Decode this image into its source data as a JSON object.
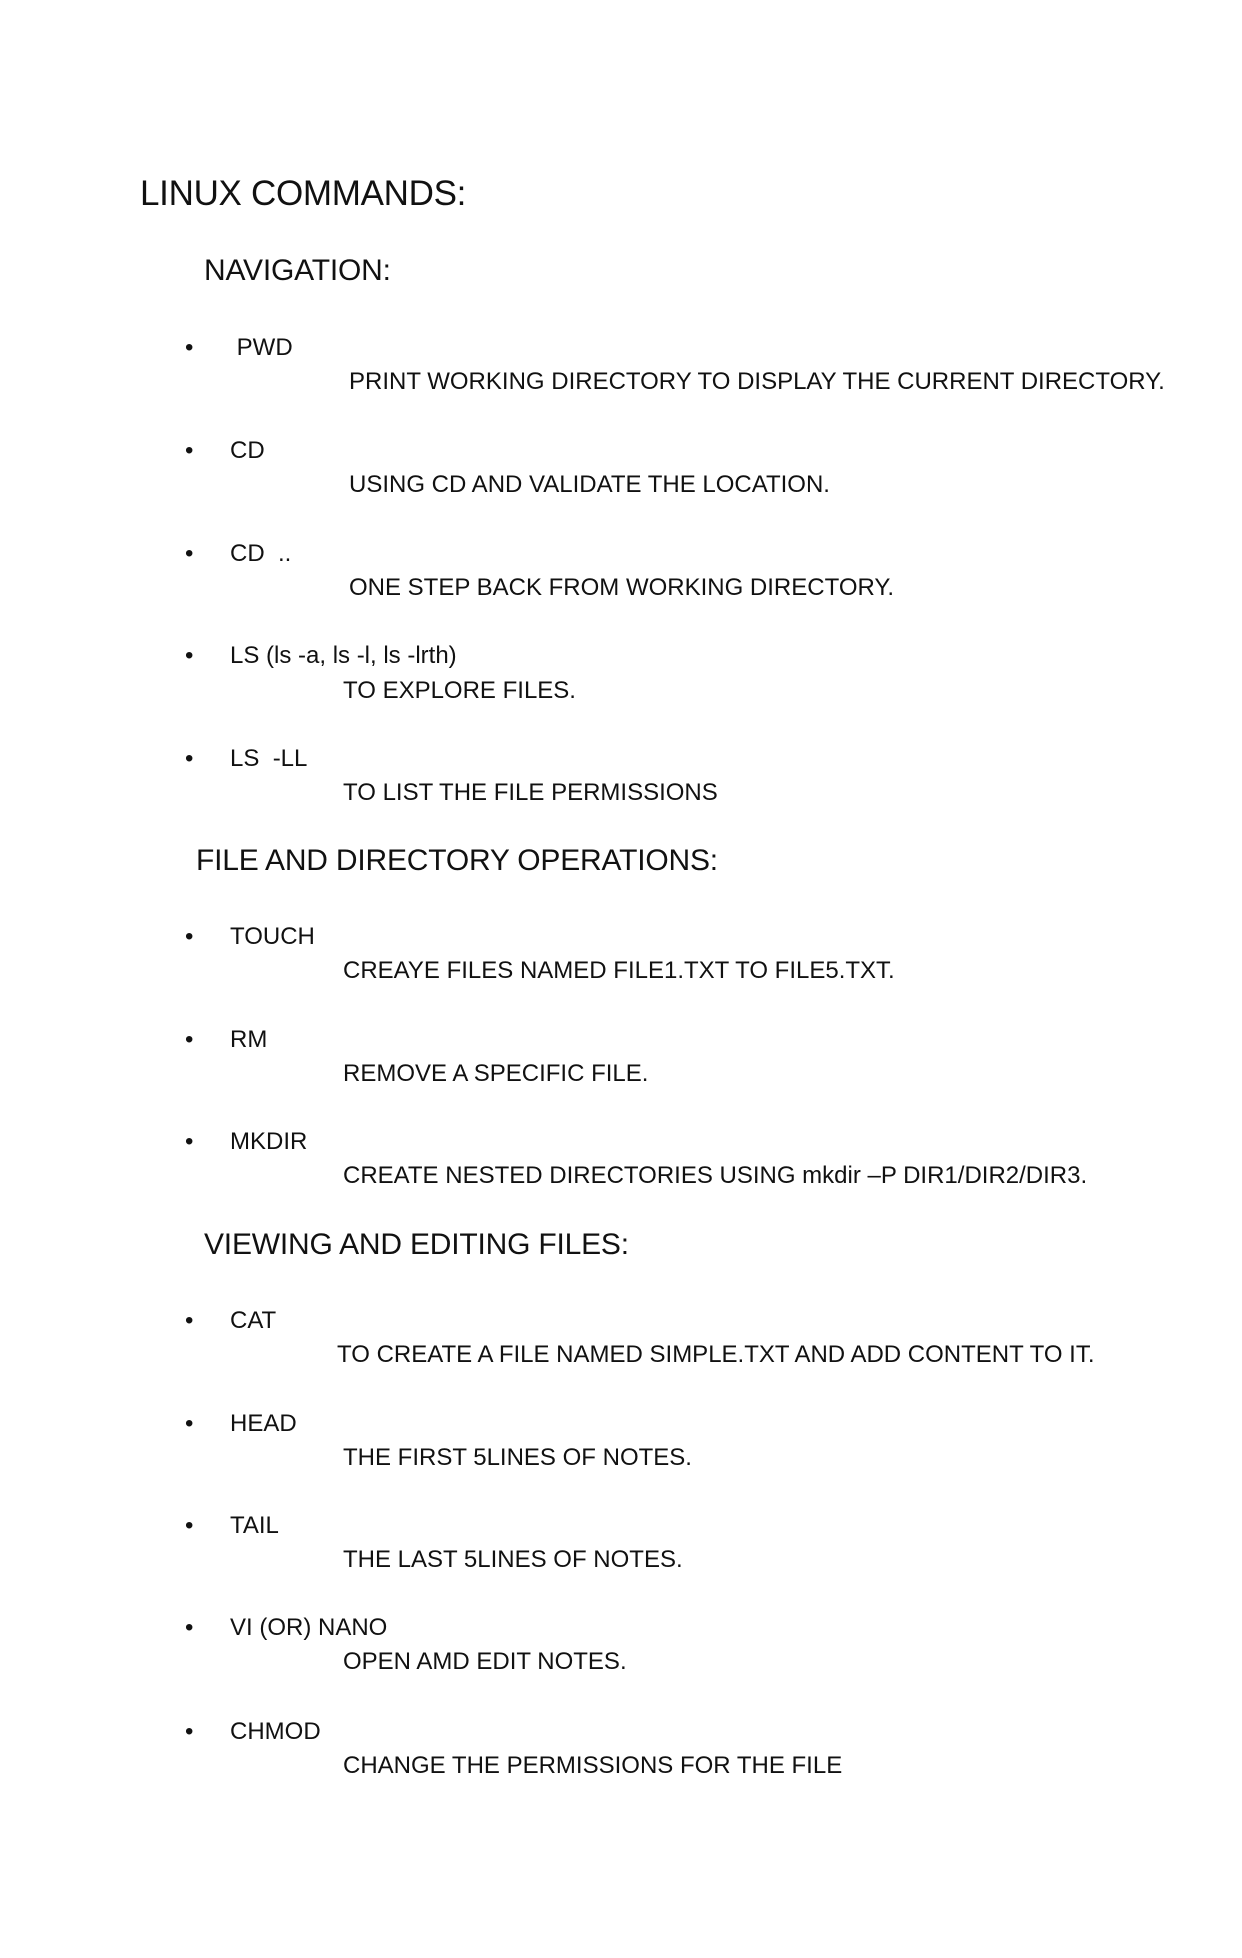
{
  "title": "LINUX COMMANDS:",
  "bullet_glyph": "•",
  "sections": [
    {
      "heading": "NAVIGATION:",
      "items": [
        {
          "command": " PWD",
          "description": "PRINT WORKING DIRECTORY TO DISPLAY THE CURRENT DIRECTORY."
        },
        {
          "command": "CD",
          "description": "USING CD AND VALIDATE THE LOCATION."
        },
        {
          "command": "CD  ..",
          "description": "ONE STEP BACK FROM WORKING DIRECTORY."
        },
        {
          "command": "LS (ls -a, ls -l, ls -lrth)",
          "description": "TO EXPLORE FILES."
        },
        {
          "command": "LS  -LL",
          "description": "TO LIST THE FILE PERMISSIONS"
        }
      ]
    },
    {
      "heading": "FILE AND DIRECTORY OPERATIONS:",
      "items": [
        {
          "command": "TOUCH",
          "description": "CREAYE FILES NAMED FILE1.TXT TO FILE5.TXT."
        },
        {
          "command": "RM",
          "description": "REMOVE A SPECIFIC FILE."
        },
        {
          "command": "MKDIR",
          "description": "CREATE NESTED DIRECTORIES USING mkdir –P DIR1/DIR2/DIR3."
        }
      ]
    },
    {
      "heading": "VIEWING AND EDITING FILES:",
      "items": [
        {
          "command": "CAT",
          "description": "TO CREATE A FILE NAMED SIMPLE.TXT AND ADD CONTENT TO IT."
        },
        {
          "command": "HEAD",
          "description": "THE FIRST 5LINES OF NOTES."
        },
        {
          "command": "TAIL",
          "description": "THE LAST 5LINES OF NOTES."
        },
        {
          "command": "VI (OR) NANO",
          "description": "OPEN AMD EDIT NOTES."
        },
        {
          "command": "CHMOD",
          "description": "CHANGE THE PERMISSIONS FOR THE FILE"
        }
      ]
    }
  ]
}
